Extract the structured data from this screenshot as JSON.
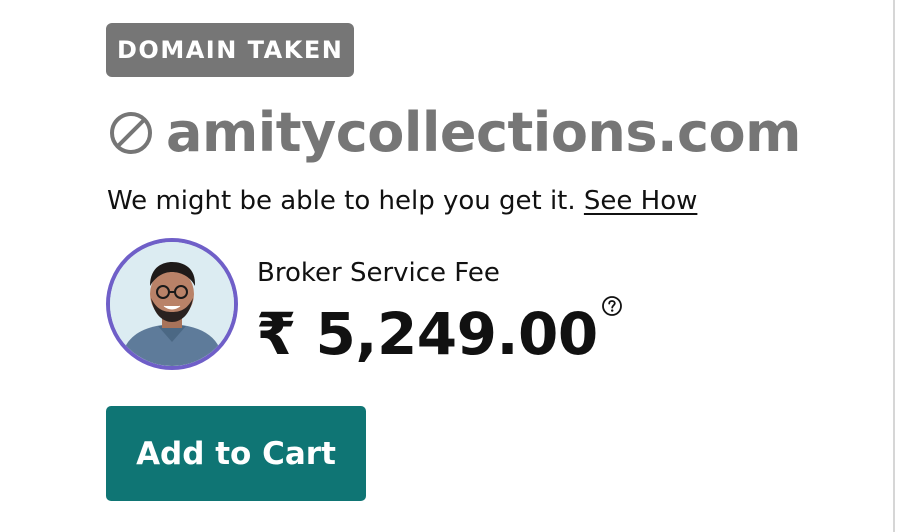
{
  "status_badge": {
    "label": "DOMAIN TAKEN",
    "color": "#767676"
  },
  "domain": {
    "name": "amitycollections.com",
    "icon": "unavailable-icon"
  },
  "help": {
    "text": "We might be able to help you get it.",
    "link_label": "See How"
  },
  "broker": {
    "avatar": "broker-avatar",
    "fee_label": "Broker Service Fee",
    "price": "₹ 5,249.00",
    "info_icon": "question-icon"
  },
  "cart_button": {
    "label": "Add to Cart",
    "color": "#0f7574"
  },
  "colors": {
    "avatar_ring": "#6f5fc8",
    "text": "#111111",
    "muted": "#767676"
  }
}
